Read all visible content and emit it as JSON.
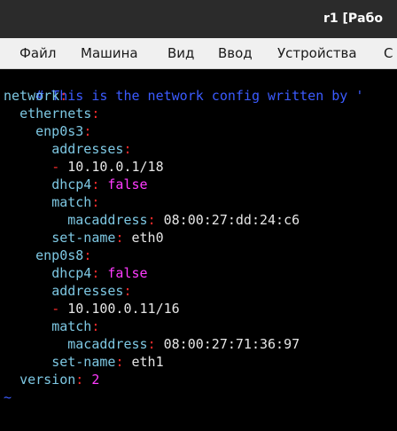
{
  "window": {
    "title": "r1 [Рабо"
  },
  "menu": {
    "items": [
      "Файл",
      "Машина",
      "Вид",
      "Ввод",
      "Устройства",
      "С"
    ]
  },
  "terminal": {
    "comment": "# This is the network config written by '",
    "network_key": "network",
    "ethernets_key": "ethernets",
    "iface1_name": "enp0s3",
    "iface1_addresses_key": "addresses",
    "iface1_address": "10.10.0.1/18",
    "iface1_dhcp_key": "dhcp4",
    "iface1_dhcp_val": "false",
    "iface1_match_key": "match",
    "iface1_mac_key": "macaddress",
    "iface1_mac_val": "08:00:27:dd:24:c6",
    "iface1_setname_key": "set-name",
    "iface1_setname_val": "eth0",
    "iface2_name": "enp0s8",
    "iface2_dhcp_key": "dhcp4",
    "iface2_dhcp_val": "false",
    "iface2_addresses_key": "addresses",
    "iface2_address": "10.100.0.11/16",
    "iface2_match_key": "match",
    "iface2_mac_key": "macaddress",
    "iface2_mac_val": "08:00:27:71:36:97",
    "iface2_setname_key": "set-name",
    "iface2_setname_val": "eth1",
    "version_key": "version",
    "version_val": "2",
    "colon": ":",
    "dash": "-",
    "tilde": "~"
  }
}
